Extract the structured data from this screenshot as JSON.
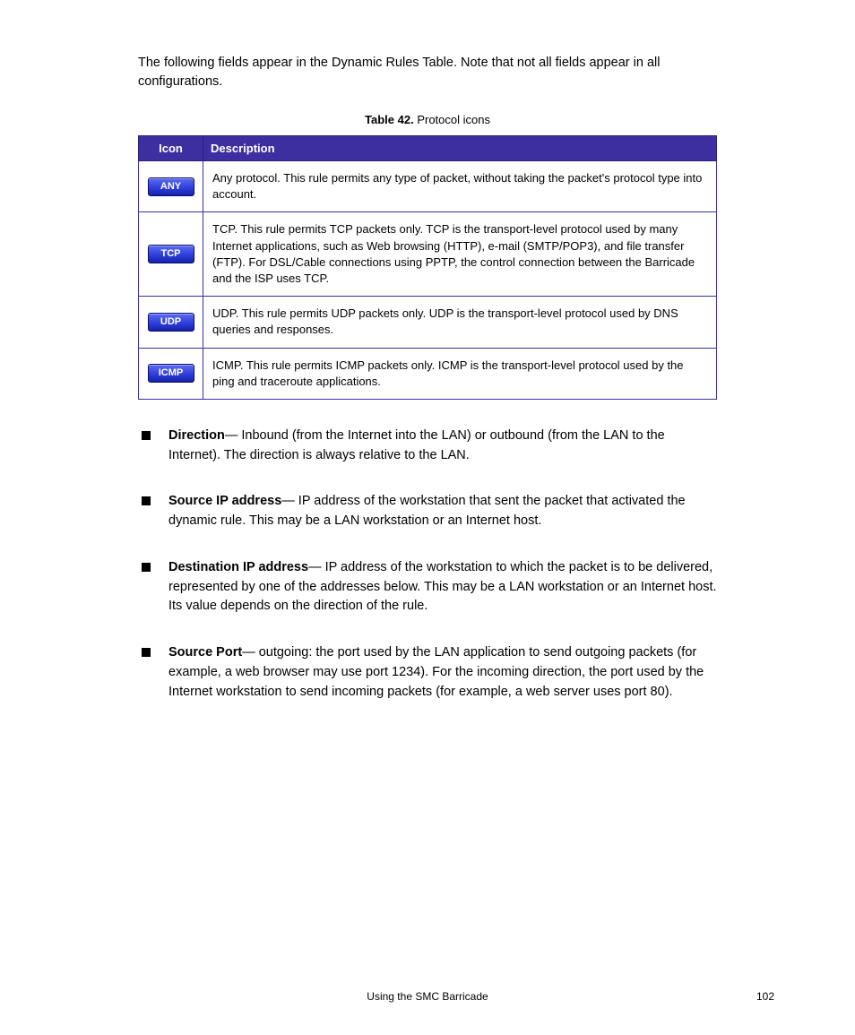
{
  "lead_paragraph": "The following fields appear in the Dynamic Rules Table. Note that not all fields appear in all configurations.",
  "table": {
    "caption_label": "Table 42.",
    "caption_text": "Protocol icons",
    "headers": {
      "icon": "Icon",
      "description": "Description"
    },
    "rows": [
      {
        "badge": "ANY",
        "name": "any-protocol-icon",
        "text": "Any protocol. This rule permits any type of packet, without taking the packet's protocol type into account."
      },
      {
        "badge": "TCP",
        "name": "tcp-protocol-icon",
        "text": "TCP. This rule permits TCP packets only. TCP is the transport-level protocol used by many Internet applications, such as Web browsing (HTTP), e-mail (SMTP/POP3), and file transfer (FTP). For DSL/Cable connections using PPTP, the control connection between the Barricade and the ISP uses TCP."
      },
      {
        "badge": "UDP",
        "name": "udp-protocol-icon",
        "text": "UDP. This rule permits UDP packets only. UDP is the transport-level protocol used by DNS queries and responses."
      },
      {
        "badge": "ICMP",
        "name": "icmp-protocol-icon",
        "text": "ICMP. This rule permits ICMP packets only. ICMP is the transport-level protocol used by the ping and traceroute applications."
      }
    ]
  },
  "bullets": [
    {
      "term": "Direction",
      "text": "— Inbound (from the Internet into the LAN) or outbound (from the LAN to the Internet). The direction is always relative to the LAN."
    },
    {
      "term": "Source IP address",
      "text": "— IP address of the workstation that sent the packet that activated the dynamic rule. This may be a LAN workstation or an Internet host."
    },
    {
      "term": "Destination IP address",
      "text": "— IP address of the workstation to which the packet is to be delivered, represented by one of the addresses below. This may be a LAN workstation or an Internet host. Its value depends on the direction of the rule."
    },
    {
      "term": "Source Port",
      "text": "— outgoing: the port used by the LAN application to send outgoing packets (for example, a web browser may use port 1234). For the incoming direction, the port used by the Internet workstation to send incoming packets (for example, a web server uses port 80)."
    }
  ],
  "footer": {
    "left": "",
    "center": "Using the SMC Barricade",
    "right": "102"
  }
}
